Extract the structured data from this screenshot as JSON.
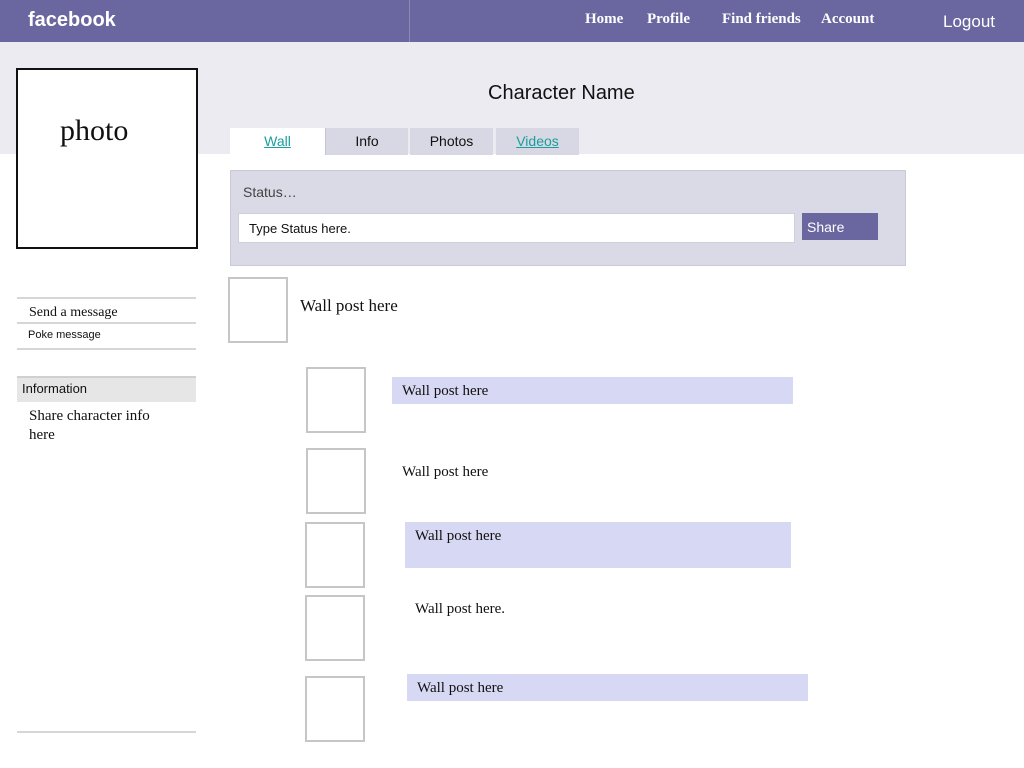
{
  "header": {
    "logo": "facebook",
    "nav": {
      "home": "Home",
      "profile": "Profile",
      "find_friends": "Find friends",
      "account": "Account"
    },
    "logout": "Logout"
  },
  "profile": {
    "photo_label": "photo",
    "character_name": "Character Name"
  },
  "tabs": {
    "wall": "Wall",
    "info": "Info",
    "photos": "Photos",
    "videos": "Videos"
  },
  "status": {
    "label": "Status…",
    "placeholder": "Type Status here.",
    "share_label": "Share"
  },
  "sidebar": {
    "send_message": "Send a message",
    "poke_message": "Poke message",
    "information_title": "Information",
    "information_text": "Share character info here"
  },
  "posts": [
    "Wall post here",
    "Wall post here",
    "Wall post here",
    "Wall post here",
    "Wall post here.",
    "Wall post here"
  ],
  "colors": {
    "header_bg": "#6a669f",
    "post_highlight": "#d7d8f3",
    "link_teal": "#1a9e9e"
  }
}
